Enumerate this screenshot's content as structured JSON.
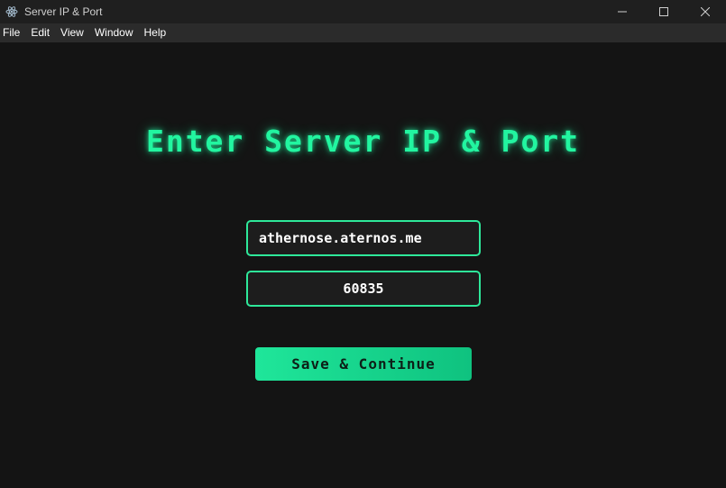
{
  "window": {
    "title": "Server IP & Port",
    "app_icon": "electron-icon",
    "controls": [
      "minimize-icon",
      "maximize-icon",
      "close-icon"
    ]
  },
  "menu": {
    "items": [
      "File",
      "Edit",
      "View",
      "Window",
      "Help"
    ]
  },
  "form": {
    "heading": "Enter Server IP & Port",
    "ip_value": "athernose.aternos.me",
    "port_value": "60835",
    "save_label": "Save & Continue"
  },
  "colors": {
    "accent": "#22f5a0",
    "button": "#1fe69a",
    "background": "#141414",
    "field_background": "#1d1d1d",
    "border": "#2ee89a"
  }
}
